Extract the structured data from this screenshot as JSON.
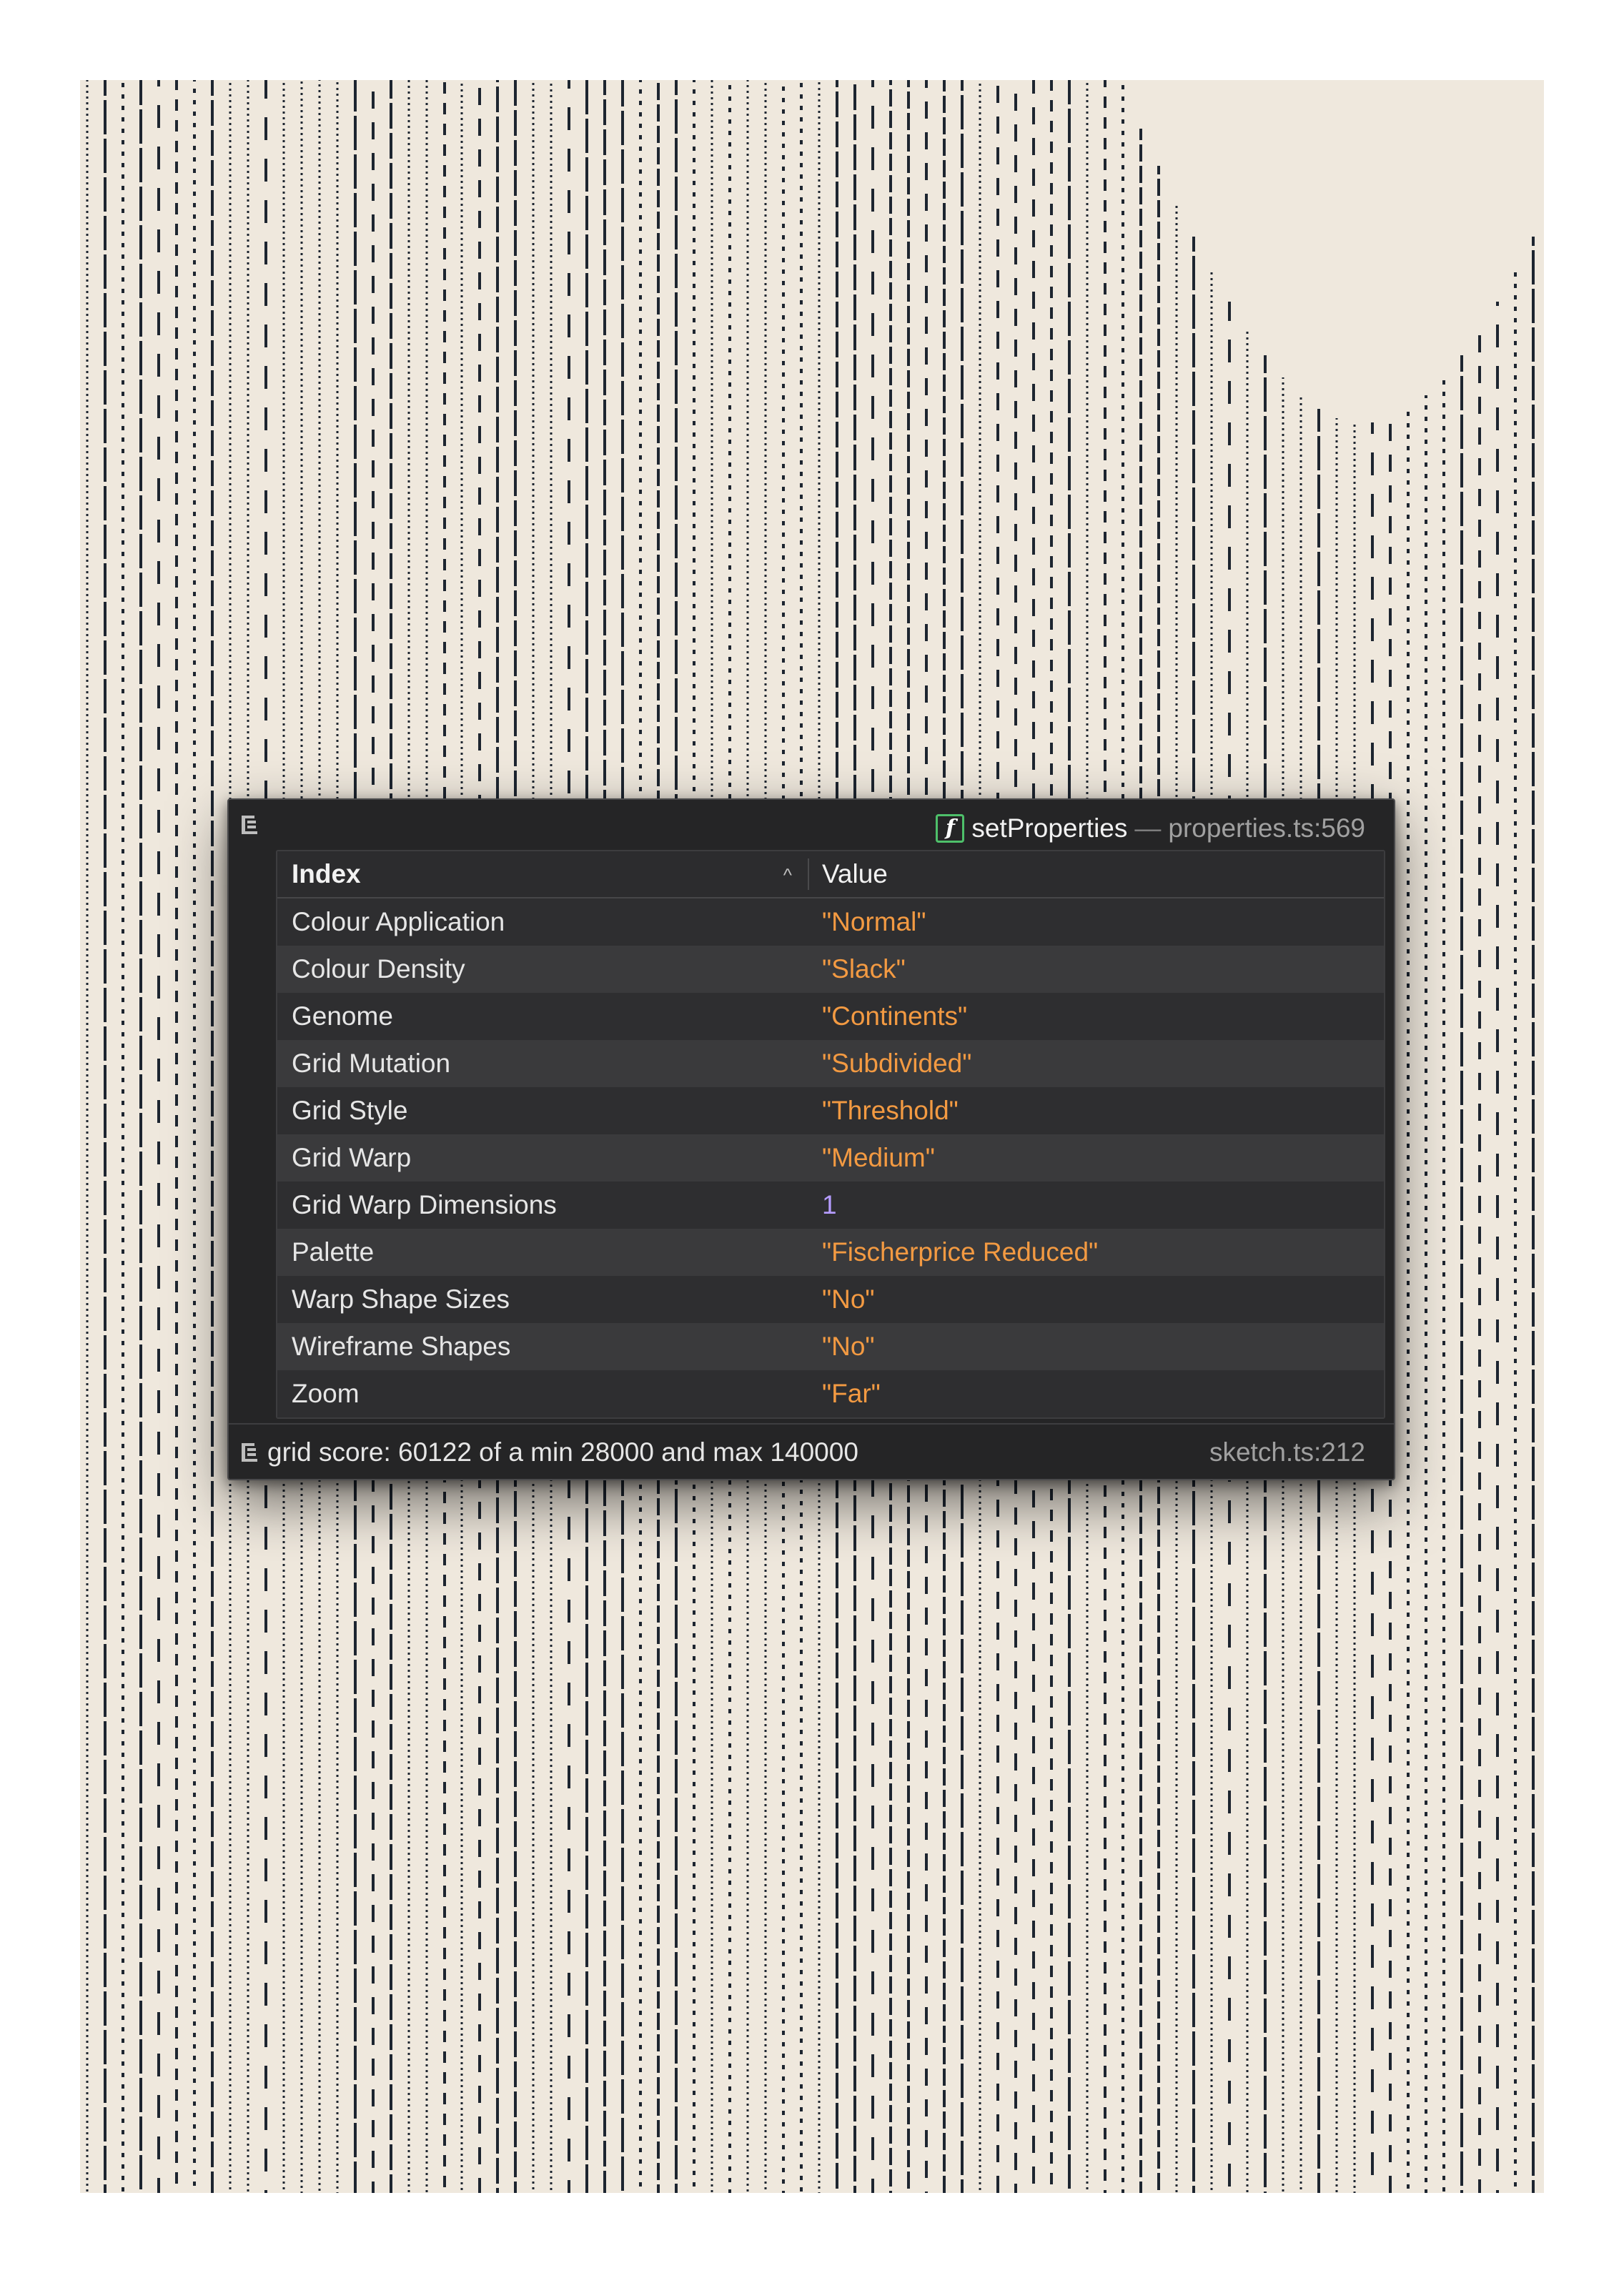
{
  "artwork": {
    "background_color": "#efe8dd",
    "ink_color": "#1d2530"
  },
  "console": {
    "caller": {
      "icon": "function-icon",
      "icon_glyph": "f",
      "function_name": "setProperties",
      "separator": "—",
      "location": "properties.ts:569"
    },
    "table": {
      "headers": {
        "index": "Index",
        "value": "Value"
      },
      "sort_indicator": "^",
      "rows": [
        {
          "index": "Colour Application",
          "value": "\"Normal\"",
          "type": "string"
        },
        {
          "index": "Colour Density",
          "value": "\"Slack\"",
          "type": "string"
        },
        {
          "index": "Genome",
          "value": "\"Continents\"",
          "type": "string"
        },
        {
          "index": "Grid Mutation",
          "value": "\"Subdivided\"",
          "type": "string"
        },
        {
          "index": "Grid Style",
          "value": "\"Threshold\"",
          "type": "string"
        },
        {
          "index": "Grid Warp",
          "value": "\"Medium\"",
          "type": "string"
        },
        {
          "index": "Grid Warp Dimensions",
          "value": "1",
          "type": "number"
        },
        {
          "index": "Palette",
          "value": "\"Fischerprice Reduced\"",
          "type": "string"
        },
        {
          "index": "Warp Shape Sizes",
          "value": "\"No\"",
          "type": "string"
        },
        {
          "index": "Wireframe Shapes",
          "value": "\"No\"",
          "type": "string"
        },
        {
          "index": "Zoom",
          "value": "\"Far\"",
          "type": "string"
        }
      ]
    },
    "footer": {
      "icon": "log-icon",
      "message": "grid score: 60122 of a min 28000 and max 140000",
      "location": "sketch.ts:212"
    }
  }
}
